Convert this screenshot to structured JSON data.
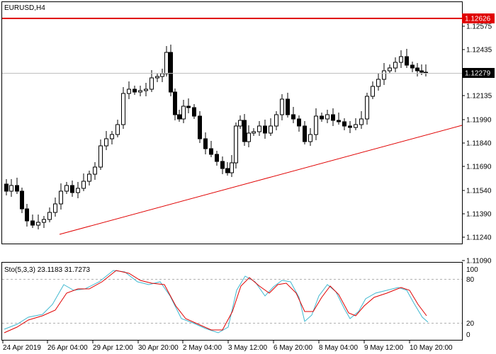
{
  "window": {
    "title": "EURUSD,H4"
  },
  "main_chart": {
    "symbol": "EURUSD,H4",
    "price_labels": [
      "1.12575",
      "1.12435",
      "1.12279",
      "1.12135",
      "1.11990",
      "1.11840",
      "1.11690",
      "1.11540",
      "1.11390",
      "1.11240",
      "1.11090"
    ],
    "resistance_label": "1.12626",
    "current_price_label": "1.12279",
    "colors": {
      "resistance": "#e00000",
      "trendline": "#e00000",
      "candle_up": "#ffffff",
      "candle_down": "#000000",
      "current_badge": "#000000",
      "resistance_badge": "#e00000"
    }
  },
  "indicator": {
    "name": "Sto(5,3,3) 23.1183 31.7273",
    "levels": [
      "100",
      "80",
      "20",
      "0"
    ],
    "colors": {
      "main": "#3fb8d0",
      "signal": "#e00000"
    }
  },
  "time_axis": {
    "labels": [
      "24 Apr 2019",
      "26 Apr 04:00",
      "29 Apr 12:00",
      "30 Apr 20:00",
      "2 May 04:00",
      "3 May 12:00",
      "6 May 20:00",
      "8 May 04:00",
      "9 May 12:00",
      "10 May 20:00"
    ]
  }
}
